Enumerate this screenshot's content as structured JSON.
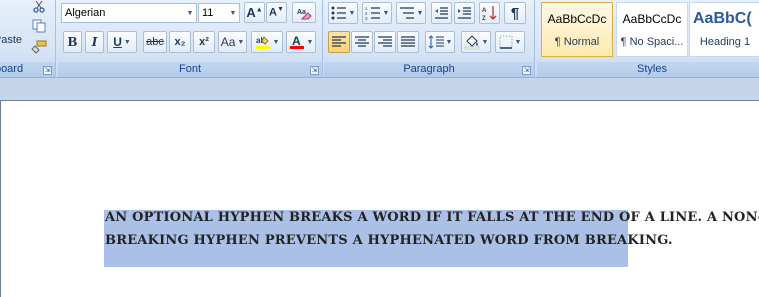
{
  "ribbon": {
    "clipboard": {
      "label": "Clipboard",
      "paste_label": "Paste"
    },
    "font": {
      "label": "Font",
      "font_name": "Algerian",
      "font_size": "11",
      "bold": "B",
      "italic": "I",
      "underline": "U",
      "strikethrough": "abc",
      "subscript": "x₂",
      "superscript": "x²",
      "change_case": "Aa",
      "grow": "A",
      "shrink": "A",
      "highlight_color": "#ffff00",
      "font_color": "#ff0000"
    },
    "paragraph": {
      "label": "Paragraph"
    },
    "styles": {
      "label": "Styles",
      "tiles": [
        {
          "sample": "AaBbCcDc",
          "name": "¶ Normal",
          "selected": true
        },
        {
          "sample": "AaBbCcDc",
          "name": "¶ No Spaci...",
          "selected": false
        },
        {
          "sample": "AaBbC(",
          "name": "Heading 1",
          "selected": false
        }
      ]
    }
  },
  "document": {
    "lines": [
      "An optional hyphen breaks a word if it falls at the end of a line. A non-",
      "breaking hyphen prevents a hyphenated word from breaking."
    ],
    "selection_color": "#aac0e6"
  }
}
